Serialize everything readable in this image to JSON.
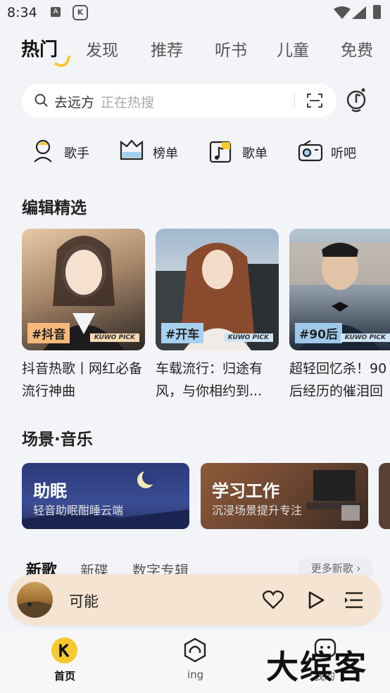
{
  "status_bar": {
    "time": "8:34",
    "a_icon": "A",
    "k_icon": "K"
  },
  "tabs": [
    {
      "label": "热门",
      "active": true
    },
    {
      "label": "发现"
    },
    {
      "label": "推荐"
    },
    {
      "label": "听书"
    },
    {
      "label": "儿童"
    },
    {
      "label": "免费"
    }
  ],
  "search": {
    "query": "去远方",
    "hint": "正在热搜"
  },
  "quick_entries": [
    {
      "label": "歌手",
      "icon": "singer-icon"
    },
    {
      "label": "榜单",
      "icon": "chart-icon"
    },
    {
      "label": "歌单",
      "icon": "playlist-icon"
    },
    {
      "label": "听吧",
      "icon": "radio-icon"
    }
  ],
  "editor_section": {
    "title": "编辑精选",
    "cards": [
      {
        "tag": "#抖音",
        "brand": "KUWO PICK",
        "caption": "抖音热歌丨网红必备流行神曲"
      },
      {
        "tag": "#开车",
        "brand": "KUWO PICK",
        "caption": "车载流行：归途有风，与你相约到..."
      },
      {
        "tag": "#90后",
        "brand": "KUWO PICK",
        "caption": "超轻回忆杀！90后经历的催泪回"
      }
    ]
  },
  "scene_section": {
    "title": "场景·音乐",
    "cards": [
      {
        "title": "助眠",
        "subtitle": "轻音助眠酣睡云端"
      },
      {
        "title": "学习工作",
        "subtitle": "沉浸场景提升专注"
      }
    ]
  },
  "new_music": {
    "tabs": [
      {
        "label": "新歌",
        "active": true
      },
      {
        "label": "新碟"
      },
      {
        "label": "数字专辑"
      }
    ],
    "more": "更多新歌"
  },
  "player": {
    "song": "可能"
  },
  "bottom_nav": [
    {
      "label": "首页",
      "active": true
    },
    {
      "label": "ing"
    },
    {
      "label": "我的"
    }
  ],
  "watermark": "大缤客",
  "colors": {
    "accent": "#f6c92f",
    "background": "#f3f4f8",
    "player_bg": "#f6e4d3"
  }
}
